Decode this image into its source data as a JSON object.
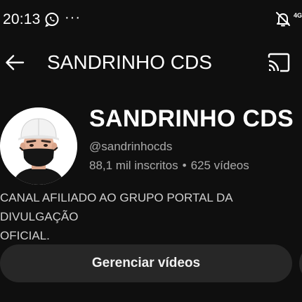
{
  "status_bar": {
    "time": "20:13",
    "more": "···",
    "network": "4G",
    "icons": [
      "whatsapp-icon",
      "more-dots-icon",
      "mute-icon"
    ]
  },
  "app_bar": {
    "title": "SANDRINHO CDS",
    "icons": [
      "back-arrow-icon",
      "cast-icon"
    ]
  },
  "channel": {
    "name": "SANDRINHO CDS",
    "handle": "@sandrinhocds",
    "subscribers": "88,1 mil inscritos",
    "separator": "•",
    "videos": "625 vídeos",
    "description": "CANAL AFILIADO AO GRUPO PORTAL DA DIVULGAÇÃO\nOFICIAL."
  },
  "actions": {
    "manage_label": "Gerenciar vídeos"
  },
  "colors": {
    "background": "#0f0f0f",
    "button": "#272727",
    "secondary_text": "#aaaaaa"
  }
}
